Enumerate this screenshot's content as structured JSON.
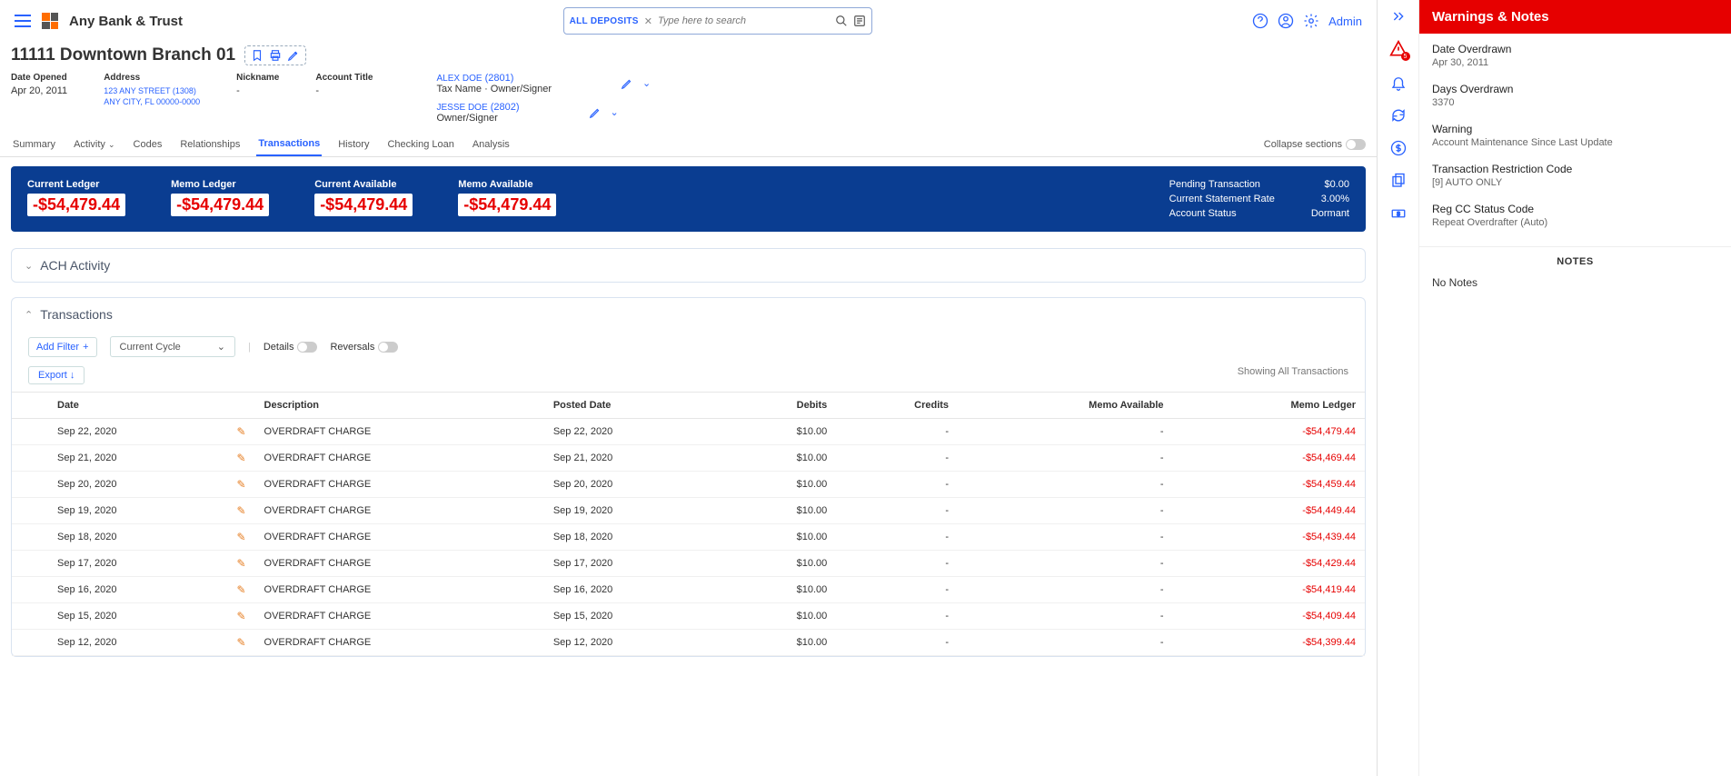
{
  "header": {
    "bank_name": "Any Bank & Trust",
    "search_pill": "ALL DEPOSITS",
    "search_placeholder": "Type here to search",
    "admin_label": "Admin"
  },
  "account": {
    "title": "11111 Downtown Branch 01",
    "date_opened_label": "Date Opened",
    "date_opened": "Apr 20, 2011",
    "address_label": "Address",
    "address_line1": "123 ANY STREET (1308)",
    "address_line2": "ANY CITY, FL 00000-0000",
    "nickname_label": "Nickname",
    "nickname": "-",
    "account_title_label": "Account Title",
    "account_title": "-",
    "owners": [
      {
        "name": "ALEX DOE",
        "num": "(2801)",
        "role": "Tax Name · Owner/Signer"
      },
      {
        "name": "JESSE DOE",
        "num": "(2802)",
        "role": "Owner/Signer"
      }
    ]
  },
  "tabs": {
    "list": [
      "Summary",
      "Activity",
      "Codes",
      "Relationships",
      "Transactions",
      "History",
      "Checking Loan",
      "Analysis"
    ],
    "active": "Transactions",
    "collapse_label": "Collapse sections"
  },
  "balances": {
    "items": [
      {
        "label": "Current Ledger",
        "value": "-$54,479.44"
      },
      {
        "label": "Memo Ledger",
        "value": "-$54,479.44"
      },
      {
        "label": "Current Available",
        "value": "-$54,479.44"
      },
      {
        "label": "Memo Available",
        "value": "-$54,479.44"
      }
    ],
    "meta": [
      {
        "label": "Pending Transaction",
        "value": "$0.00"
      },
      {
        "label": "Current Statement Rate",
        "value": "3.00%"
      },
      {
        "label": "Account Status",
        "value": "Dormant"
      }
    ]
  },
  "sections": {
    "ach": "ACH Activity",
    "transactions": "Transactions"
  },
  "trans_controls": {
    "add_filter": "Add Filter",
    "cycle": "Current Cycle",
    "details": "Details",
    "reversals": "Reversals",
    "export": "Export",
    "showing": "Showing All Transactions"
  },
  "table": {
    "headers": {
      "date": "Date",
      "desc": "Description",
      "posted": "Posted Date",
      "debits": "Debits",
      "credits": "Credits",
      "memo_avail": "Memo Available",
      "memo_ledger": "Memo Ledger"
    },
    "rows": [
      {
        "date": "Sep 22, 2020",
        "desc": "OVERDRAFT CHARGE",
        "posted": "Sep 22, 2020",
        "debits": "$10.00",
        "credits": "-",
        "memo_avail": "-",
        "memo_ledger": "-$54,479.44"
      },
      {
        "date": "Sep 21, 2020",
        "desc": "OVERDRAFT CHARGE",
        "posted": "Sep 21, 2020",
        "debits": "$10.00",
        "credits": "-",
        "memo_avail": "-",
        "memo_ledger": "-$54,469.44"
      },
      {
        "date": "Sep 20, 2020",
        "desc": "OVERDRAFT CHARGE",
        "posted": "Sep 20, 2020",
        "debits": "$10.00",
        "credits": "-",
        "memo_avail": "-",
        "memo_ledger": "-$54,459.44"
      },
      {
        "date": "Sep 19, 2020",
        "desc": "OVERDRAFT CHARGE",
        "posted": "Sep 19, 2020",
        "debits": "$10.00",
        "credits": "-",
        "memo_avail": "-",
        "memo_ledger": "-$54,449.44"
      },
      {
        "date": "Sep 18, 2020",
        "desc": "OVERDRAFT CHARGE",
        "posted": "Sep 18, 2020",
        "debits": "$10.00",
        "credits": "-",
        "memo_avail": "-",
        "memo_ledger": "-$54,439.44"
      },
      {
        "date": "Sep 17, 2020",
        "desc": "OVERDRAFT CHARGE",
        "posted": "Sep 17, 2020",
        "debits": "$10.00",
        "credits": "-",
        "memo_avail": "-",
        "memo_ledger": "-$54,429.44"
      },
      {
        "date": "Sep 16, 2020",
        "desc": "OVERDRAFT CHARGE",
        "posted": "Sep 16, 2020",
        "debits": "$10.00",
        "credits": "-",
        "memo_avail": "-",
        "memo_ledger": "-$54,419.44"
      },
      {
        "date": "Sep 15, 2020",
        "desc": "OVERDRAFT CHARGE",
        "posted": "Sep 15, 2020",
        "debits": "$10.00",
        "credits": "-",
        "memo_avail": "-",
        "memo_ledger": "-$54,409.44"
      },
      {
        "date": "Sep 12, 2020",
        "desc": "OVERDRAFT CHARGE",
        "posted": "Sep 12, 2020",
        "debits": "$10.00",
        "credits": "-",
        "memo_avail": "-",
        "memo_ledger": "-$54,399.44"
      }
    ]
  },
  "warnings": {
    "title": "Warnings & Notes",
    "items": [
      {
        "title": "Date Overdrawn",
        "sub": "Apr 30, 2011"
      },
      {
        "title": "Days Overdrawn",
        "sub": "3370"
      },
      {
        "title": "Warning",
        "sub": "Account Maintenance Since Last Update"
      },
      {
        "title": "Transaction Restriction Code",
        "sub": "[9] AUTO ONLY"
      },
      {
        "title": "Reg CC Status Code",
        "sub": "Repeat Overdrafter (Auto)"
      }
    ],
    "notes_head": "NOTES",
    "no_notes": "No Notes",
    "rail_badge": "5"
  }
}
